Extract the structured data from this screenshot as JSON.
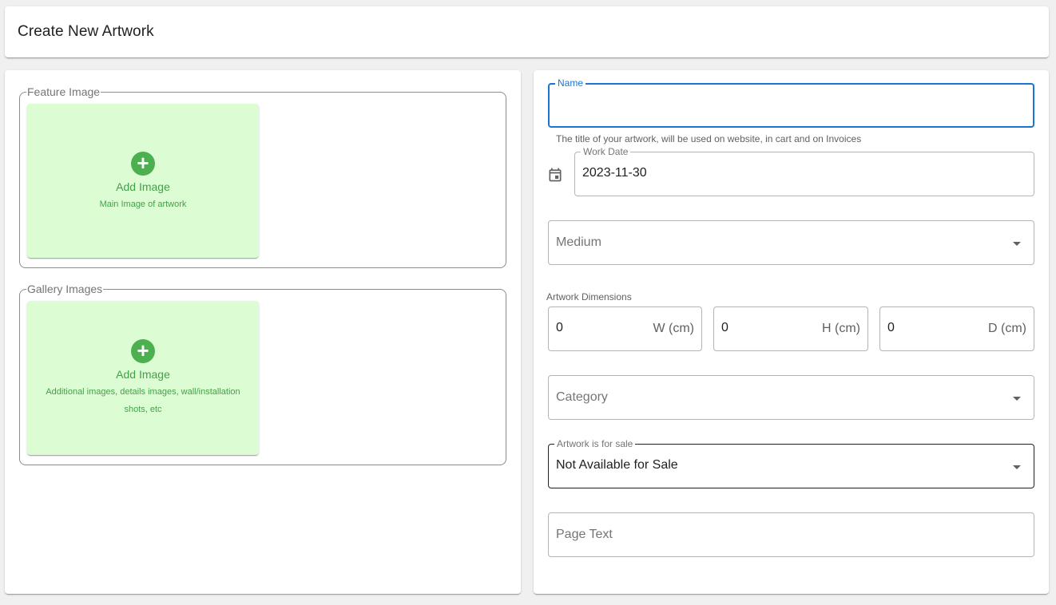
{
  "header": {
    "title": "Create New Artwork"
  },
  "feature_image": {
    "legend": "Feature Image",
    "add_label": "Add Image",
    "hint": "Main Image of artwork"
  },
  "gallery_images": {
    "legend": "Gallery Images",
    "add_label": "Add Image",
    "hint": "Additional images, details images, wall/installation shots, etc"
  },
  "form": {
    "name": {
      "label": "Name",
      "value": "",
      "helper": "The title of your artwork, will be used on website, in cart and on Invoices"
    },
    "work_date": {
      "label": "Work Date",
      "value": "2023-11-30"
    },
    "medium": {
      "placeholder": "Medium"
    },
    "dimensions": {
      "label": "Artwork Dimensions",
      "width": {
        "value": "0",
        "unit": "W (cm)"
      },
      "height": {
        "value": "0",
        "unit": "H (cm)"
      },
      "depth": {
        "value": "0",
        "unit": "D (cm)"
      }
    },
    "category": {
      "placeholder": "Category"
    },
    "for_sale": {
      "label": "Artwork is for sale",
      "value": "Not Available for Sale"
    },
    "page_text": {
      "placeholder": "Page Text"
    }
  },
  "colors": {
    "accent": "#1976d2",
    "drop_zone_bg": "#dcfdd4",
    "drop_zone_text": "#43a047",
    "add_icon": "#4caf50"
  },
  "icons": {
    "add": "plus-circle-icon",
    "calendar": "calendar-icon",
    "dropdown": "chevron-down-icon"
  }
}
